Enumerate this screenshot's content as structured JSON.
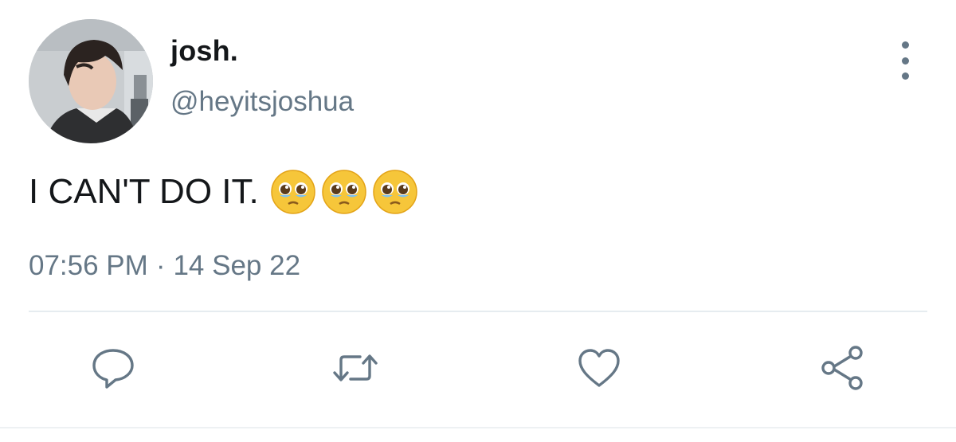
{
  "author": {
    "display_name": "josh.",
    "handle": "@heyitsjoshua",
    "avatar_icon": "profile-photo"
  },
  "tweet": {
    "text": "I CAN'T DO IT.",
    "emojis": [
      "pleading-face",
      "pleading-face",
      "pleading-face"
    ],
    "time": "07:56 PM",
    "separator": "·",
    "date": "14 Sep 22"
  },
  "actions": [
    {
      "name": "reply",
      "icon": "speech-bubble-icon"
    },
    {
      "name": "retweet",
      "icon": "retweet-icon"
    },
    {
      "name": "like",
      "icon": "heart-icon"
    },
    {
      "name": "share",
      "icon": "share-icon"
    }
  ],
  "colors": {
    "text": "#14171a",
    "secondary": "#657786",
    "divider": "#e6ecf0"
  }
}
